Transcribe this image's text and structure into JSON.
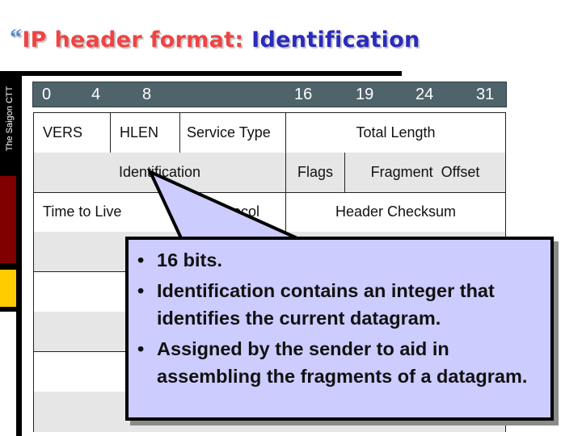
{
  "slide": {
    "title_quote": "“",
    "title_prefix": "IP header format:",
    "title_highlight": "Identification",
    "org_label": "The Saigon CTT"
  },
  "colors": {
    "title_red": "#ee4444",
    "title_blue": "#2b2bbb",
    "header_bar": "#4f636b",
    "callout_fill": "#ccccff",
    "side_red": "#800000",
    "side_yellow": "#ffcc00"
  },
  "bit_header": [
    "0",
    "4",
    "8",
    "16",
    "19",
    "24",
    "31"
  ],
  "table": {
    "rows": [
      {
        "cells": [
          "VERS",
          "HLEN",
          "Service Type",
          "Total Length"
        ]
      },
      {
        "cells": [
          "Identification",
          "Flags",
          "Fragment  Offset"
        ]
      },
      {
        "cells": [
          "Time to Live",
          "Protocol",
          "Header Checksum"
        ]
      },
      {
        "cells": []
      },
      {
        "cells": []
      },
      {
        "cells": []
      },
      {
        "cells": []
      },
      {
        "cells": []
      }
    ]
  },
  "callout": {
    "bullet_glyph": "•",
    "bullets": [
      "16 bits.",
      "Identification contains an integer that identifies the current datagram.",
      "Assigned by the sender to aid in assembling the fragments of a datagram."
    ]
  }
}
